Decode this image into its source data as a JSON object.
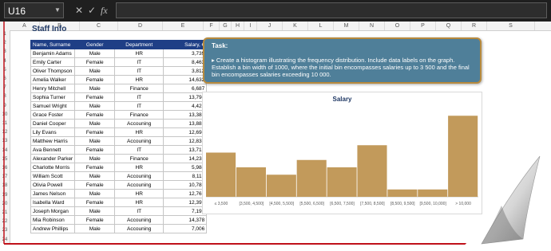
{
  "formula_bar": {
    "name_box": "U16",
    "cancel_icon": "✕",
    "enter_icon": "✓",
    "fx_label": "fx",
    "formula": ""
  },
  "columns": [
    "A",
    "B",
    "C",
    "D",
    "E",
    "F",
    "G",
    "H",
    "I",
    "J",
    "K",
    "L",
    "M",
    "N",
    "O",
    "P",
    "Q",
    "R",
    "S"
  ],
  "rows": [
    "1",
    "2",
    "3",
    "4",
    "5",
    "6",
    "7",
    "8",
    "9",
    "10",
    "11",
    "12",
    "13",
    "14",
    "15",
    "16",
    "17",
    "18",
    "19",
    "20",
    "21",
    "22",
    "23",
    "24"
  ],
  "sheet_title": "Staff Info",
  "table": {
    "headers": [
      "Name, Surname",
      "Gender",
      "Department",
      "Salary, €"
    ],
    "rows": [
      [
        "Benjamin Adams",
        "Male",
        "HR",
        "3,739"
      ],
      [
        "Emily Carter",
        "Female",
        "IT",
        "8,463"
      ],
      [
        "Oliver Thompson",
        "Male",
        "IT",
        "3,812"
      ],
      [
        "Amelia Walker",
        "Female",
        "HR",
        "14,632"
      ],
      [
        "Henry Mitchell",
        "Male",
        "Finance",
        "6,687"
      ],
      [
        "Sophia Turner",
        "Female",
        "IT",
        "13,794"
      ],
      [
        "Samuel Wright",
        "Male",
        "IT",
        "4,422"
      ],
      [
        "Grace Foster",
        "Female",
        "Finance",
        "13,383"
      ],
      [
        "Daniel Cooper",
        "Male",
        "Accouning",
        "13,882"
      ],
      [
        "Lily Evans",
        "Female",
        "HR",
        "12,694"
      ],
      [
        "Matthew Harris",
        "Male",
        "Accouning",
        "12,835"
      ],
      [
        "Ava Bennett",
        "Female",
        "IT",
        "13,713"
      ],
      [
        "Alexander Parker",
        "Male",
        "Finance",
        "14,238"
      ],
      [
        "Charlotte Morris",
        "Female",
        "HR",
        "5,984"
      ],
      [
        "William Scott",
        "Male",
        "Accouning",
        "8,117"
      ],
      [
        "Olivia Powell",
        "Female",
        "Accouning",
        "10,787"
      ],
      [
        "James Nelson",
        "Male",
        "HR",
        "12,767"
      ],
      [
        "Isabella Ward",
        "Female",
        "HR",
        "12,396"
      ],
      [
        "Joseph Morgan",
        "Male",
        "IT",
        "7,195"
      ],
      [
        "Mia Robinson",
        "Female",
        "Accouning",
        "14,378"
      ],
      [
        "Andrew Phillips",
        "Male",
        "Accouning",
        "7,006"
      ]
    ]
  },
  "task": {
    "title": "Task:",
    "text": "▸ Create a histogram illustrating the frequency distribution. Include data labels on the graph. Establish a bin width of 1000, where the initial bin encompasses salaries up to 3 500 and the final bin encompasses salaries exceeding 10 000."
  },
  "colors": {
    "bar": "#c29a5b",
    "task_bg": "#4f7f99",
    "task_border": "#b88a3d",
    "header_bg": "#1f3f86",
    "frame_red": "#c0111a"
  },
  "chart_data": {
    "type": "bar",
    "title": "Salary",
    "categories": [
      "≤ 3,500",
      "[3,500, 4,500]",
      "[4,500, 5,500]",
      "[5,500, 6,500]",
      "[6,500, 7,500]",
      "[7,500, 8,500]",
      "[8,500, 9,500]",
      "[9,500, 10,000]",
      "> 10,000"
    ],
    "values": [
      3,
      2,
      1.5,
      2.5,
      2,
      3.5,
      0.5,
      0.5,
      5.5
    ],
    "ylim": [
      0,
      6
    ],
    "xlabel": "",
    "ylabel": "",
    "grid": false,
    "legend": "none"
  }
}
